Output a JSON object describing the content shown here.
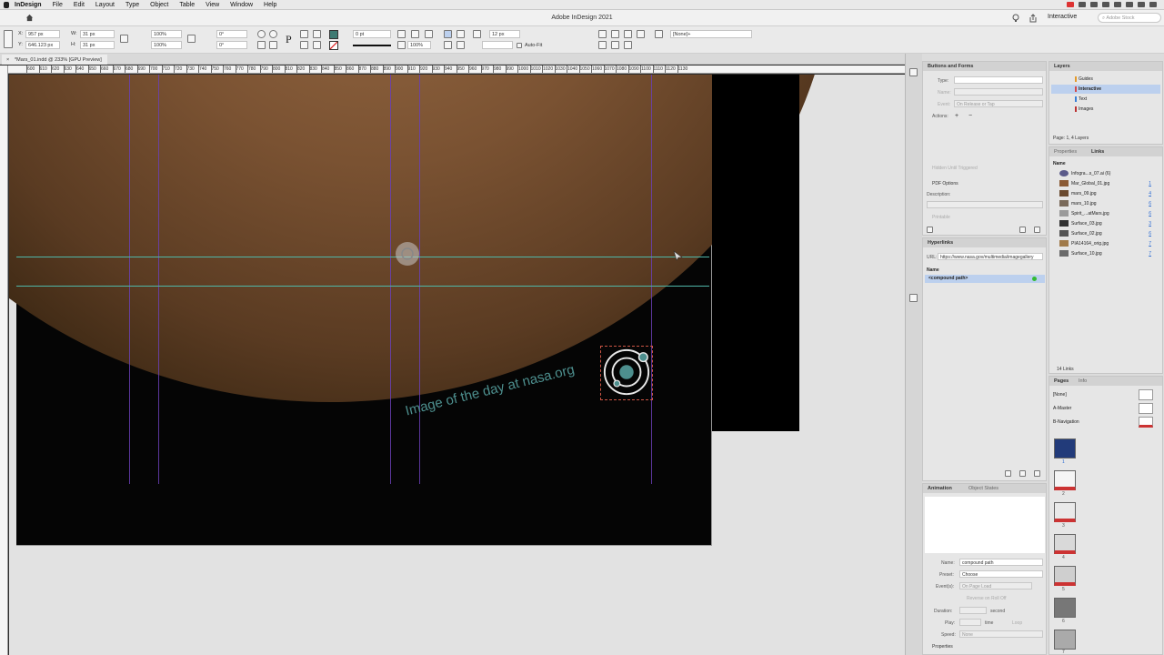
{
  "menubar": {
    "app": "InDesign",
    "items": [
      "File",
      "Edit",
      "Layout",
      "Type",
      "Object",
      "Table",
      "View",
      "Window",
      "Help"
    ]
  },
  "appbar": {
    "title": "Adobe InDesign 2021",
    "workspace": "Interactive",
    "search_placeholder": "Adobe Stock"
  },
  "control": {
    "x_label": "X:",
    "x_value": "957 px",
    "y_label": "Y:",
    "y_value": "646.123 px",
    "w_label": "W:",
    "w_value": "31 px",
    "h_label": "H:",
    "h_value": "31 px",
    "scale_x": "100%",
    "scale_y": "100%",
    "angle": "0°",
    "shear": "0°",
    "stroke_weight": "0 pt",
    "gutter": "12 px",
    "opacity": "100%",
    "autofit_label": "Auto-Fit",
    "object_style": "[None]+"
  },
  "document": {
    "tab": "*Mars_01.indd @ 233% [GPU Preview]"
  },
  "ruler": {
    "ticks": [
      "600",
      "610",
      "620",
      "630",
      "640",
      "650",
      "660",
      "670",
      "680",
      "690",
      "700",
      "710",
      "720",
      "730",
      "740",
      "750",
      "760",
      "770",
      "780",
      "790",
      "800",
      "810",
      "820",
      "830",
      "840",
      "850",
      "860",
      "870",
      "880",
      "890",
      "900",
      "910",
      "920",
      "930",
      "940",
      "950",
      "960",
      "970",
      "980",
      "990",
      "1000",
      "1010",
      "1020",
      "1030",
      "1040",
      "1050",
      "1060",
      "1070",
      "1080",
      "1090",
      "1100",
      "1110",
      "1120",
      "1130"
    ]
  },
  "canvas": {
    "caption": "Image of the day at nasa.org"
  },
  "buttons_forms": {
    "title": "Buttons and Forms",
    "type_label": "Type:",
    "name_label": "Name:",
    "event_label": "Event:",
    "event_value": "On Release or Tap",
    "actions_label": "Actions:",
    "hidden_label": "Hidden Until Triggered",
    "pdf_options": "PDF Options",
    "description_label": "Description:",
    "printable_label": "Printable"
  },
  "hyperlinks": {
    "title": "Hyperlinks",
    "url_label": "URL:",
    "url_value": "https://www.nasa.gov/multimedia/imagegallery",
    "name_header": "Name",
    "item": "<compound path>"
  },
  "animation": {
    "tab_animation": "Animation",
    "tab_object_states": "Object States",
    "name_label": "Name:",
    "name_value": "compound path",
    "preset_label": "Preset:",
    "preset_value": "Choose",
    "events_label": "Event(s):",
    "events_value": "On Page Load",
    "reverse_label": "Reverse on Roll Off",
    "duration_label": "Duration:",
    "duration_unit": "second",
    "play_label": "Play:",
    "play_unit": "time",
    "loop_label": "Loop",
    "speed_label": "Speed:",
    "speed_value": "None",
    "properties_label": "Properties"
  },
  "layers": {
    "title": "Layers",
    "items": [
      {
        "name": "Guides",
        "color": "#e39a2b",
        "selected": false
      },
      {
        "name": "Interactive",
        "color": "#d24a4a",
        "selected": true
      },
      {
        "name": "Text",
        "color": "#3a7fd6",
        "selected": false
      },
      {
        "name": "Images",
        "color": "#b33",
        "selected": false
      }
    ],
    "status": "Page: 1, 4 Layers"
  },
  "links": {
    "tab_properties": "Properties",
    "tab_links": "Links",
    "name_header": "Name",
    "items": [
      {
        "name": "Infogra...s_07.ai (6)",
        "page": ""
      },
      {
        "name": "Mar_Global_01.jpg",
        "page": "1"
      },
      {
        "name": "mars_09.jpg",
        "page": "4"
      },
      {
        "name": "mars_10.jpg",
        "page": "6"
      },
      {
        "name": "Spirit_...atMars.jpg",
        "page": "6"
      },
      {
        "name": "Surface_03.jpg",
        "page": "3"
      },
      {
        "name": "Surface_02.jpg",
        "page": "6"
      },
      {
        "name": "PIA14164_orig.jpg",
        "page": "7"
      },
      {
        "name": "Surface_10.jpg",
        "page": "7"
      }
    ],
    "status": "14 Links"
  },
  "pages": {
    "tab_pages": "Pages",
    "tab_info": "Info",
    "masters": [
      "[None]",
      "A-Master",
      "B-Navigation"
    ],
    "page_numbers": [
      "1",
      "2",
      "3",
      "4",
      "5",
      "6",
      "7"
    ]
  }
}
